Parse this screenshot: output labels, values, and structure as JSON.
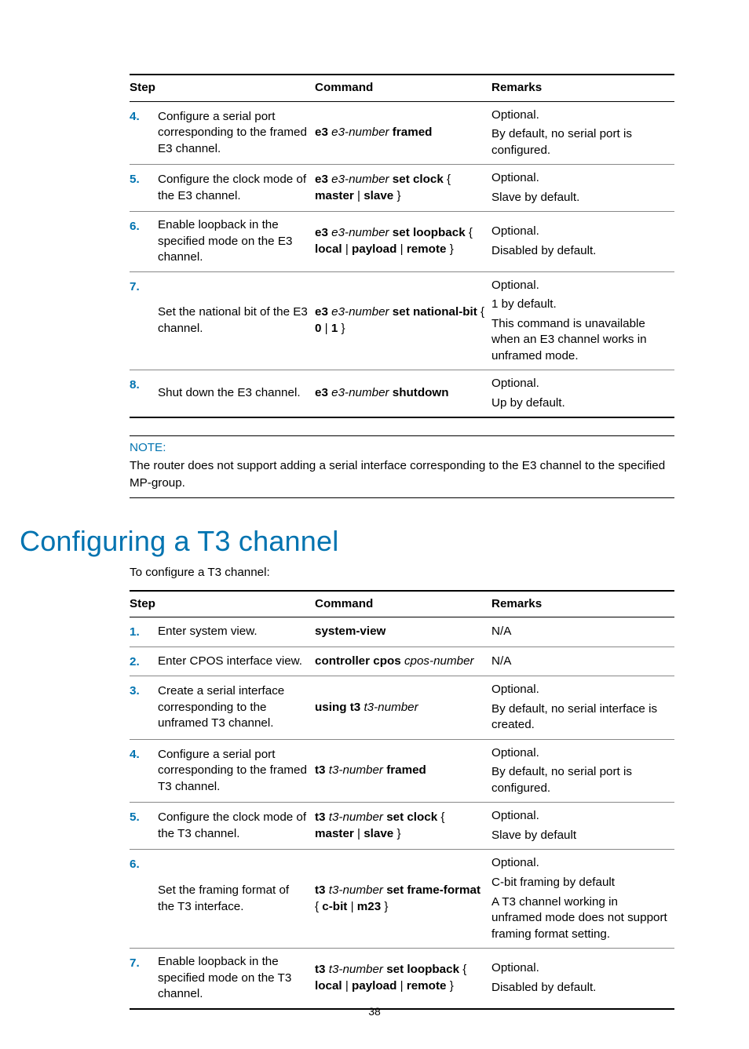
{
  "table1": {
    "headers": {
      "step": "Step",
      "command": "Command",
      "remarks": "Remarks"
    },
    "rows": [
      {
        "num": "4.",
        "step": "Configure a serial port corresponding to the framed E3 channel.",
        "cmd": [
          {
            "t": "e3 ",
            "c": "b"
          },
          {
            "t": "e3-number",
            "c": "i"
          },
          {
            "t": " framed",
            "c": "b"
          }
        ],
        "rem": [
          "Optional.",
          "By default, no serial port is configured."
        ]
      },
      {
        "num": "5.",
        "step": "Configure the clock mode of the E3 channel.",
        "cmd": [
          {
            "t": "e3 ",
            "c": "b"
          },
          {
            "t": "e3-number",
            "c": "i"
          },
          {
            "t": " set clock",
            "c": "b"
          },
          {
            "t": " { ",
            "c": ""
          },
          {
            "t": "master",
            "c": "b"
          },
          {
            "t": " | ",
            "c": ""
          },
          {
            "t": "slave",
            "c": "b"
          },
          {
            "t": " }",
            "c": ""
          }
        ],
        "rem": [
          "Optional.",
          "Slave by default."
        ]
      },
      {
        "num": "6.",
        "step": "Enable loopback in the specified mode on the E3 channel.",
        "cmd": [
          {
            "t": "e3 ",
            "c": "b"
          },
          {
            "t": "e3-number",
            "c": "i"
          },
          {
            "t": " set loopback",
            "c": "b"
          },
          {
            "t": " { ",
            "c": ""
          },
          {
            "t": "local",
            "c": "b"
          },
          {
            "t": " | ",
            "c": ""
          },
          {
            "t": "payload",
            "c": "b"
          },
          {
            "t": " | ",
            "c": ""
          },
          {
            "t": "remote",
            "c": "b"
          },
          {
            "t": " }",
            "c": ""
          }
        ],
        "rem": [
          "Optional.",
          "Disabled by default."
        ]
      },
      {
        "num": "7.",
        "step": "Set the national bit of the E3 channel.",
        "cmd": [
          {
            "t": "e3 ",
            "c": "b"
          },
          {
            "t": "e3-number",
            "c": "i"
          },
          {
            "t": " set national-bit",
            "c": "b"
          },
          {
            "t": " { ",
            "c": ""
          },
          {
            "t": "0",
            "c": "b"
          },
          {
            "t": " | ",
            "c": ""
          },
          {
            "t": "1",
            "c": "b"
          },
          {
            "t": " }",
            "c": ""
          }
        ],
        "rem": [
          "Optional.",
          "1 by default.",
          "This command is unavailable when an E3 channel works in unframed mode."
        ]
      },
      {
        "num": "8.",
        "step": "Shut down the E3 channel.",
        "cmd": [
          {
            "t": "e3 ",
            "c": "b"
          },
          {
            "t": "e3-number",
            "c": "i"
          },
          {
            "t": " shutdown",
            "c": "b"
          }
        ],
        "rem": [
          "Optional.",
          "Up by default."
        ]
      }
    ]
  },
  "note": {
    "label": "NOTE:",
    "text": "The router does not support adding a serial interface corresponding to the E3 channel to the specified MP-group."
  },
  "heading": "Configuring a T3 channel",
  "lead": "To configure a T3 channel:",
  "table2": {
    "headers": {
      "step": "Step",
      "command": "Command",
      "remarks": "Remarks"
    },
    "rows": [
      {
        "num": "1.",
        "step": "Enter system view.",
        "cmd": [
          {
            "t": "system-view",
            "c": "b"
          }
        ],
        "rem": [
          "N/A"
        ]
      },
      {
        "num": "2.",
        "step": "Enter CPOS interface view.",
        "cmd": [
          {
            "t": "controller cpos ",
            "c": "b"
          },
          {
            "t": "cpos-number",
            "c": "i"
          }
        ],
        "rem": [
          "N/A"
        ]
      },
      {
        "num": "3.",
        "step": "Create a serial interface corresponding to the unframed T3 channel.",
        "cmd": [
          {
            "t": "using t3 ",
            "c": "b"
          },
          {
            "t": "t3-number",
            "c": "i"
          }
        ],
        "rem": [
          "Optional.",
          "By default, no serial interface is created."
        ]
      },
      {
        "num": "4.",
        "step": "Configure a serial port corresponding to the framed T3 channel.",
        "cmd": [
          {
            "t": "t3 ",
            "c": "b"
          },
          {
            "t": "t3-number",
            "c": "i"
          },
          {
            "t": " framed",
            "c": "b"
          }
        ],
        "rem": [
          "Optional.",
          "By default, no serial port is configured."
        ]
      },
      {
        "num": "5.",
        "step": "Configure the clock mode of the T3 channel.",
        "cmd": [
          {
            "t": "t3 ",
            "c": "b"
          },
          {
            "t": "t3-number",
            "c": "i"
          },
          {
            "t": " set clock",
            "c": "b"
          },
          {
            "t": " { ",
            "c": ""
          },
          {
            "t": "master",
            "c": "b"
          },
          {
            "t": " | ",
            "c": ""
          },
          {
            "t": "slave",
            "c": "b"
          },
          {
            "t": " }",
            "c": ""
          }
        ],
        "rem": [
          "Optional.",
          "Slave by default"
        ]
      },
      {
        "num": "6.",
        "step": "Set the framing format of the T3 interface.",
        "cmd": [
          {
            "t": "t3 ",
            "c": "b"
          },
          {
            "t": "t3-number",
            "c": "i"
          },
          {
            "t": " set frame-format",
            "c": "b"
          },
          {
            "t": " { ",
            "c": ""
          },
          {
            "t": "c-bit",
            "c": "b"
          },
          {
            "t": " | ",
            "c": ""
          },
          {
            "t": "m23",
            "c": "b"
          },
          {
            "t": " }",
            "c": ""
          }
        ],
        "rem": [
          "Optional.",
          "C-bit framing by default",
          "A T3 channel working in unframed mode does not support framing format setting."
        ]
      },
      {
        "num": "7.",
        "step": "Enable loopback in the specified mode on the T3 channel.",
        "cmd": [
          {
            "t": "t3 ",
            "c": "b"
          },
          {
            "t": "t3-number",
            "c": "i"
          },
          {
            "t": " set loopback",
            "c": "b"
          },
          {
            "t": " { ",
            "c": ""
          },
          {
            "t": "local",
            "c": "b"
          },
          {
            "t": " | ",
            "c": ""
          },
          {
            "t": "payload",
            "c": "b"
          },
          {
            "t": " | ",
            "c": ""
          },
          {
            "t": "remote",
            "c": "b"
          },
          {
            "t": " }",
            "c": ""
          }
        ],
        "rem": [
          "Optional.",
          "Disabled by default."
        ]
      }
    ]
  },
  "page_number": "38"
}
